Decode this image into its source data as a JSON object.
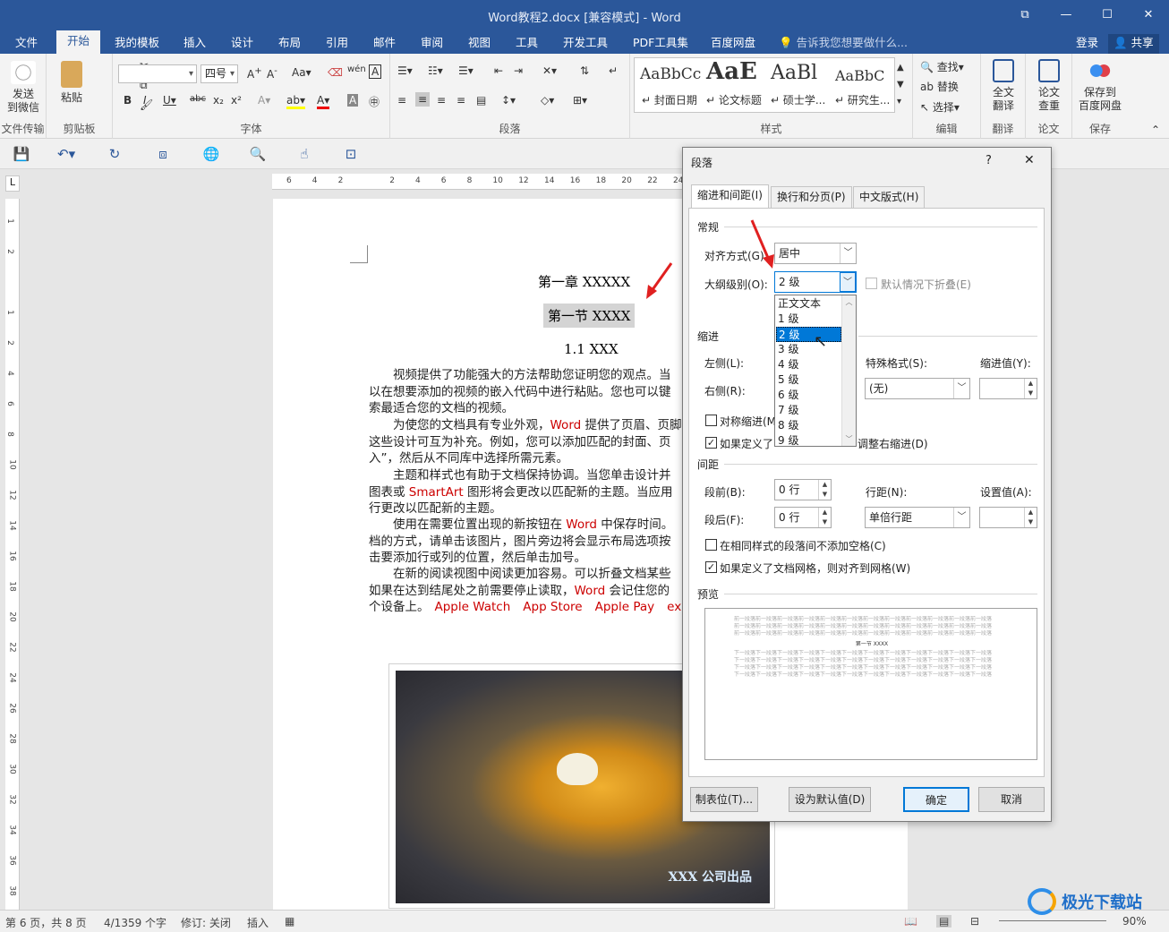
{
  "titlebar": {
    "title": "Word教程2.docx [兼容模式] - Word"
  },
  "menu": {
    "tabs": [
      "文件",
      "开始",
      "我的模板",
      "插入",
      "设计",
      "布局",
      "引用",
      "邮件",
      "审阅",
      "视图",
      "工具",
      "开发工具",
      "PDF工具集",
      "百度网盘"
    ],
    "tell_me": "告诉我您想要做什么...",
    "login": "登录",
    "share": "共享"
  },
  "ribbon": {
    "send_wechat": "发送\n到微信",
    "file_transfer": "文件传输",
    "paste": "粘贴",
    "clipboard": "剪贴板",
    "font_size": "四号",
    "font_group": "字体",
    "paragraph_group": "段落",
    "styles": [
      {
        "sample": "AaBbCc",
        "name": "↵ 封面日期"
      },
      {
        "sample": "AaE",
        "name": "↵ 论文标题"
      },
      {
        "sample": "AaBl",
        "name": "↵ 硕士学..."
      },
      {
        "sample": "AaBbC",
        "name": "↵ 研究生..."
      }
    ],
    "styles_group": "样式",
    "find": "查找",
    "replace": "替换",
    "select": "选择",
    "edit_group": "编辑",
    "translate": "全文\n翻译",
    "translate_group": "翻译",
    "check": "论文\n查重",
    "paper_group": "论文",
    "save_baidu": "保存到\n百度网盘",
    "save_group": "保存"
  },
  "ruler": {
    "h": [
      "6",
      "4",
      "2",
      "",
      "2",
      "4",
      "6",
      "8",
      "10",
      "12",
      "14",
      "16",
      "18",
      "20",
      "22",
      "24"
    ],
    "v": [
      "1",
      "2",
      "",
      "1",
      "2",
      "4",
      "6",
      "8",
      "10",
      "12",
      "14",
      "16",
      "18",
      "20",
      "22",
      "24",
      "26",
      "28",
      "30",
      "32",
      "34",
      "36",
      "38"
    ]
  },
  "document": {
    "chapter": "第一章  XXXXX",
    "section": "第一节  XXXX",
    "sub": "1.1 XXX",
    "paragraphs": [
      [
        "视频提供了功能强大的方法帮助您证明您的观点。当",
        "以在想要添加的视频的嵌入代码中进行粘贴。您也可以键",
        "索最适合您的文档的视频。"
      ],
      [
        "为使您的文档具有专业外观，",
        "Word",
        " 提供了页眉、页脚",
        "这些设计可互为补充。例如，您可以添加匹配的封面、页",
        "入”，然后从不同库中选择所需元素。"
      ],
      [
        "主题和样式也有助于文档保持协调。当您单击设计并",
        "图表或 ",
        "SmartArt",
        " 图形将会更改以匹配新的主题。当应用",
        "行更改以匹配新的主题。"
      ],
      [
        "使用在需要位置出现的新按钮在 ",
        "Word",
        " 中保存时间。",
        "档的方式，请单击该图片，图片旁边将会显示布局选项按",
        "击要添加行或列的位置，然后单击加号。"
      ],
      [
        "在新的阅读视图中阅读更加容易。可以折叠文档某些",
        "如果在达到结尾处之前需要停止读取，",
        "Word",
        " 会记住您的",
        "个设备上。",
        "Apple Watch",
        "App Store",
        "Apple Pay",
        "exampl"
      ]
    ],
    "image_caption": "XXX 公司出品"
  },
  "dialog": {
    "title": "段落",
    "help": "?",
    "close": "✕",
    "tabs": [
      "缩进和间距(I)",
      "换行和分页(P)",
      "中文版式(H)"
    ],
    "general": "常规",
    "align_label": "对齐方式(G):",
    "align_value": "居中",
    "outline_label": "大纲级别(O):",
    "outline_value": "2 级",
    "collapse_label": "默认情况下折叠(E)",
    "indent": "缩进",
    "left_label": "左侧(L):",
    "right_label": "右侧(R):",
    "special_label": "特殊格式(S):",
    "special_value": "(无)",
    "indent_value_label": "缩进值(Y):",
    "mirror_label": "对称缩进(M",
    "grid_right_a": "如果定义了",
    "grid_right_b": "调整右缩进(D)",
    "spacing": "间距",
    "before_label": "段前(B):",
    "before_value": "0 行",
    "after_label": "段后(F):",
    "after_value": "0 行",
    "line_label": "行距(N):",
    "line_value": "单倍行距",
    "set_label": "设置值(A):",
    "no_space_label": "在相同样式的段落间不添加空格(C)",
    "snap_grid_label": "如果定义了文档网格，则对齐到网格(W)",
    "preview": "预览",
    "preview_prev": "前一段落前一段落前一段落前一段落前一段落前一段落前一段落前一段落前一段落前一段落前一段落前一段落",
    "preview_title": "第一节 XXXX",
    "preview_next": "下一段落下一段落下一段落下一段落下一段落下一段落下一段落下一段落下一段落下一段落下一段落下一段落",
    "tabs_btn": "制表位(T)...",
    "default_btn": "设为默认值(D)",
    "ok": "确定",
    "cancel": "取消",
    "levels": [
      "正文文本",
      "1 级",
      "2 级",
      "3 级",
      "4 级",
      "5 级",
      "6 级",
      "7 级",
      "8 级",
      "9 级"
    ],
    "selected_level": "2 级"
  },
  "status": {
    "page": "第 6 页，共 8 页",
    "words": "4/1359 个字",
    "revision": "修订: 关闭",
    "insert": "插入",
    "zoom": "90%"
  },
  "watermark": "极光下载站",
  "colors": {
    "accent": "#2b579a",
    "selected": "#0078d7",
    "arrow": "#e02020",
    "red_text": "#cc0000"
  }
}
